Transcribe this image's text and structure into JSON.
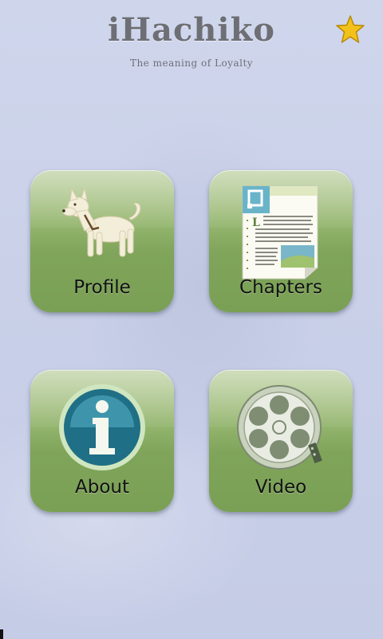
{
  "header": {
    "title": "iHachiko",
    "subtitle": "The meaning of Loyalty",
    "favorite_icon": "star-icon"
  },
  "tiles": [
    {
      "id": "profile",
      "label": "Profile",
      "icon": "dog-icon"
    },
    {
      "id": "chapters",
      "label": "Chapters",
      "icon": "document-icon"
    },
    {
      "id": "about",
      "label": "About",
      "icon": "info-icon"
    },
    {
      "id": "video",
      "label": "Video",
      "icon": "film-reel-icon"
    }
  ],
  "colors": {
    "background": "#cbd2ea",
    "tile_green": "#8fb168",
    "star": "#f2c21b"
  }
}
